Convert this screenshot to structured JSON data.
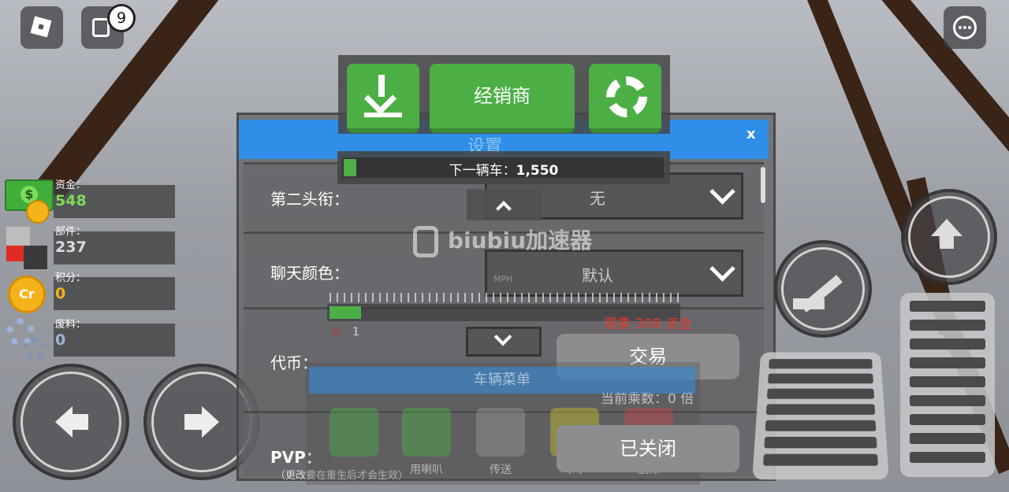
{
  "top_left": {
    "notification_count": "9"
  },
  "stats": [
    {
      "label": "资金：",
      "value": "548",
      "color": "#7ddc5b",
      "icon": "money-icon"
    },
    {
      "label": "部件：",
      "value": "237",
      "color": "#dcdcdc",
      "icon": "parts-icon"
    },
    {
      "label": "积分：",
      "value": "0",
      "color": "#f5b31b",
      "icon": "credit-coin-icon"
    },
    {
      "label": "废料：",
      "value": "0",
      "color": "#9cb4d9",
      "icon": "scrap-gear-icon"
    }
  ],
  "top_bar": {
    "dealer_label": "经销商"
  },
  "progress": {
    "label": "下一辆车：",
    "value": "1,550",
    "fraction": 0.04
  },
  "settings": {
    "title": "设置",
    "close": "x",
    "rows": [
      {
        "label": "第二头衔：",
        "value": "无"
      },
      {
        "label": "聊天颜色：",
        "value": "默认"
      },
      {
        "label": "代币：",
        "value": ""
      },
      {
        "label": "PVP：",
        "subtext": "（更改要在重生后才会生效）"
      }
    ]
  },
  "overlay": {
    "watermark": "biubiu加速器",
    "gear_r": "R",
    "gear_1": "1",
    "speed_unit": "MPH",
    "requirement": "需要 30B 资金",
    "trade_label": "交易",
    "multiplier": "当前乘数：0 倍",
    "closed_label": "已关闭",
    "vehicle_menu": "车辆菜单",
    "vehicle_menu_items": [
      "",
      "用喇叭",
      "传送",
      "车车",
      "删除"
    ]
  },
  "colors": {
    "accent_blue": "#2f8fe8",
    "green": "#4caf45",
    "warning_red": "#e03a2f"
  }
}
